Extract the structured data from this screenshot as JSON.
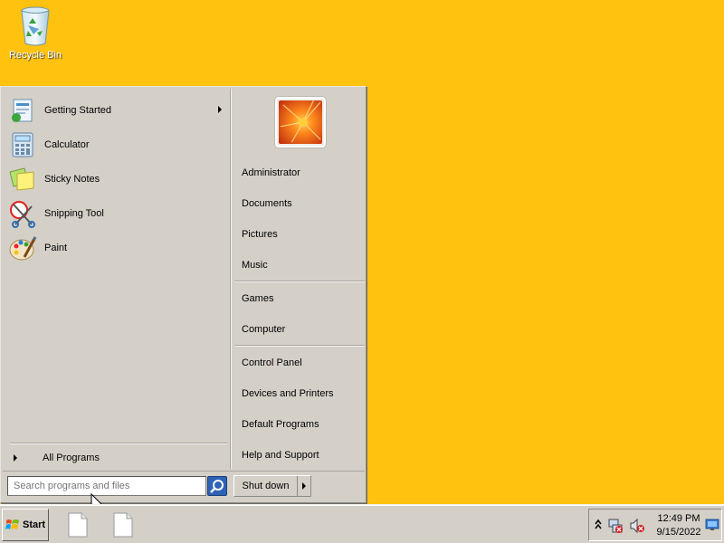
{
  "desktop": {
    "icons": [
      {
        "label": "Recycle Bin",
        "icon": "recycle-bin-icon"
      }
    ],
    "background_color": "#FFC20E"
  },
  "start_menu": {
    "programs": [
      {
        "label": "Getting Started",
        "icon": "getting-started-icon",
        "has_submenu": true
      },
      {
        "label": "Calculator",
        "icon": "calculator-icon"
      },
      {
        "label": "Sticky Notes",
        "icon": "sticky-notes-icon"
      },
      {
        "label": "Snipping Tool",
        "icon": "snipping-tool-icon"
      },
      {
        "label": "Paint",
        "icon": "paint-icon"
      }
    ],
    "all_programs_label": "All Programs",
    "search": {
      "placeholder": "Search programs and files",
      "value": ""
    },
    "user_picture": "flower-avatar",
    "right_items": [
      {
        "label": "Administrator"
      },
      {
        "label": "Documents"
      },
      {
        "label": "Pictures"
      },
      {
        "label": "Music"
      },
      {
        "label": "Games"
      },
      {
        "label": "Computer"
      },
      {
        "label": "Control Panel"
      },
      {
        "label": "Devices and Printers"
      },
      {
        "label": "Default Programs"
      },
      {
        "label": "Help and Support"
      }
    ],
    "shutdown_label": "Shut down"
  },
  "taskbar": {
    "start_label": "Start",
    "pinned": [
      {
        "icon": "blank-file-icon"
      },
      {
        "icon": "blank-file-icon"
      }
    ],
    "tray": {
      "icons": [
        "show-hidden-icons",
        "network-error-icon",
        "volume-muted-icon"
      ],
      "time": "12:49 PM",
      "date": "9/15/2022"
    }
  }
}
